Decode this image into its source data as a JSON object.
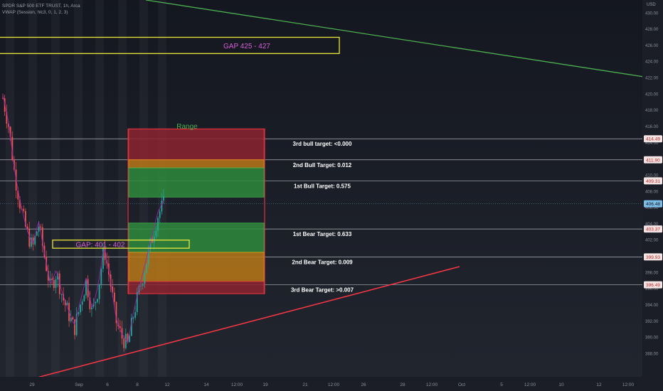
{
  "header": {
    "symbol_line": "SPDR S&P 500 ETF TRUST, 1h, Arca",
    "indicator_line": "VWAP (Session, hlc3, 0, 1, 2, 3)"
  },
  "currency": "USD",
  "colors": {
    "background": "#1b1e27",
    "bull": "#26a69a",
    "bear": "#ef5350",
    "vwap": "#9c27b0",
    "gap_box": "#e8e63a",
    "gap_text": "#d65fd6",
    "range_text": "#4caf50",
    "resistance_line": "#4caf50",
    "support_line": "#f23645",
    "red_zone": "#8c2430",
    "orange_zone": "#b87818",
    "green_zone": "#2e8a3c",
    "current_price_bg": "#7bbde6"
  },
  "chart_data": {
    "type": "candlestick",
    "y_axis": {
      "range": [
        386.9,
        430.9
      ],
      "ticks": [
        "388.00",
        "390.00",
        "392.00",
        "394.00",
        "396.00",
        "398.00",
        "400.00",
        "402.00",
        "404.00",
        "406.00",
        "408.00",
        "410.00",
        "412.00",
        "414.00",
        "416.00",
        "418.00",
        "420.00",
        "422.00",
        "424.00",
        "426.00",
        "428.00",
        "430.00"
      ]
    },
    "x_axis": {
      "ticks": [
        "29",
        "Sep",
        "6",
        "8",
        "12",
        "14",
        "12:00",
        "19",
        "21",
        "12:00",
        "26",
        "28",
        "12:00",
        "Oct",
        "5",
        "12:00",
        "10",
        "12",
        "12:00"
      ]
    },
    "price_labels": [
      "414.49",
      "411.90",
      "409.31",
      "406.48",
      "403.37",
      "399.93",
      "396.49"
    ],
    "current_price": "406.48",
    "range_label": "Range",
    "gaps": [
      {
        "label": "GAP 425 - 427",
        "low": 425,
        "high": 427
      },
      {
        "label": "GAP: 401 - 402",
        "low": 401,
        "high": 402
      }
    ],
    "targets": [
      {
        "label": "3rd bull target: <0.000",
        "price": 414.49
      },
      {
        "label": "2nd Bull Target: 0.012",
        "price": 411.9
      },
      {
        "label": "1st Bull Target: 0.575",
        "price": 409.31
      },
      {
        "label": "1st Bear Target: 0.633",
        "price": 403.37
      },
      {
        "label": "2nd Bear Target: 0.009",
        "price": 399.93
      },
      {
        "label": "3rd Bear Target: >0.007",
        "price": 396.49
      }
    ],
    "zones": [
      {
        "kind": "red",
        "top": 415.7,
        "bottom": 411.9
      },
      {
        "kind": "orange",
        "top": 411.9,
        "bottom": 410.9
      },
      {
        "kind": "green",
        "top": 410.9,
        "bottom": 407.3
      },
      {
        "kind": "green",
        "top": 404.1,
        "bottom": 400.5
      },
      {
        "kind": "orange",
        "top": 400.5,
        "bottom": 396.9
      },
      {
        "kind": "red",
        "top": 396.9,
        "bottom": 395.4
      }
    ],
    "price_path": [
      419.5,
      416,
      410,
      406,
      403,
      401,
      404,
      400,
      396,
      398,
      395,
      393,
      391,
      394,
      397,
      393,
      396,
      401,
      397,
      392,
      390,
      389,
      393,
      396,
      399,
      402,
      405,
      406.48
    ]
  }
}
